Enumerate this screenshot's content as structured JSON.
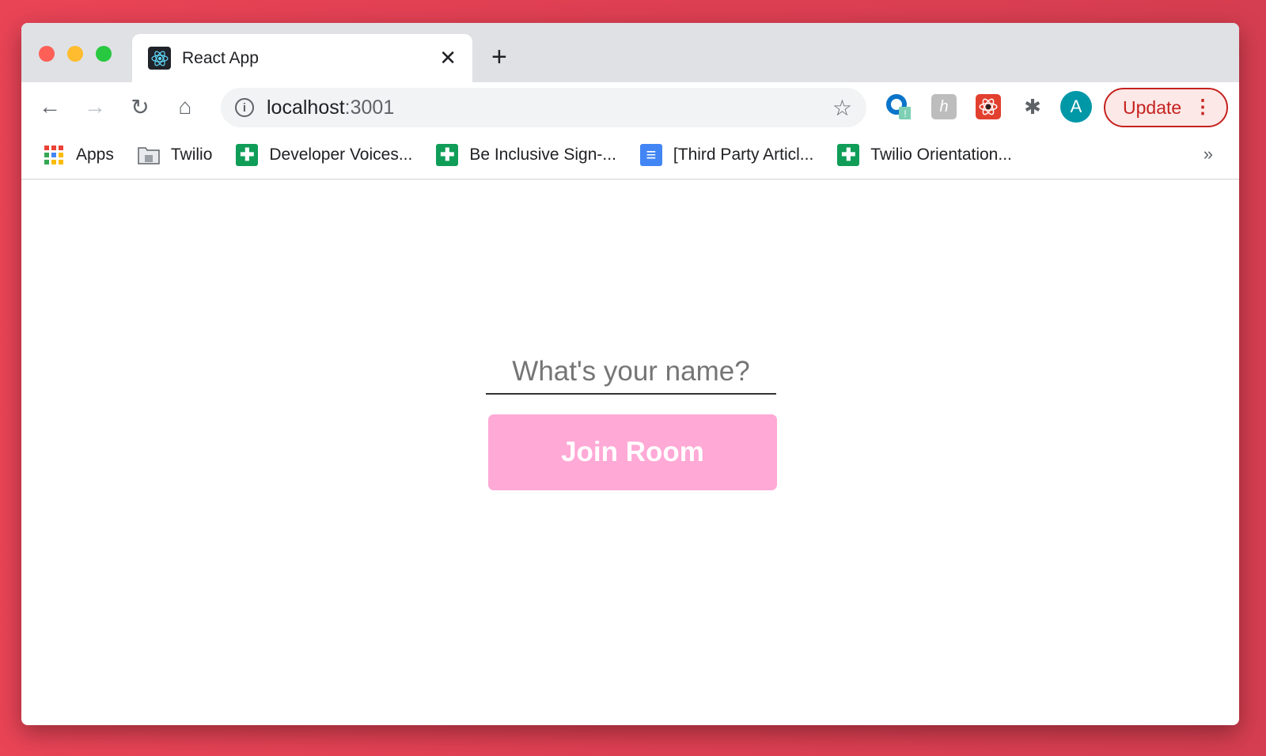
{
  "browser": {
    "tab": {
      "title": "React App",
      "favicon": "react-logo-icon"
    },
    "address": {
      "host": "localhost",
      "port": ":3001"
    },
    "profile_initial": "A",
    "update_label": "Update",
    "bookmarks": [
      {
        "label": "Apps",
        "icon": "apps-grid-icon"
      },
      {
        "label": "Twilio",
        "icon": "folder-icon"
      },
      {
        "label": "Developer Voices...",
        "icon": "google-sheets-icon"
      },
      {
        "label": "Be Inclusive Sign-...",
        "icon": "google-sheets-icon"
      },
      {
        "label": "[Third Party Articl...",
        "icon": "google-docs-icon"
      },
      {
        "label": "Twilio Orientation...",
        "icon": "google-sheets-icon"
      }
    ],
    "more_label": "»"
  },
  "page": {
    "name_placeholder": "What's your name?",
    "name_value": "",
    "join_label": "Join Room",
    "join_color": "#ffa9d6"
  }
}
